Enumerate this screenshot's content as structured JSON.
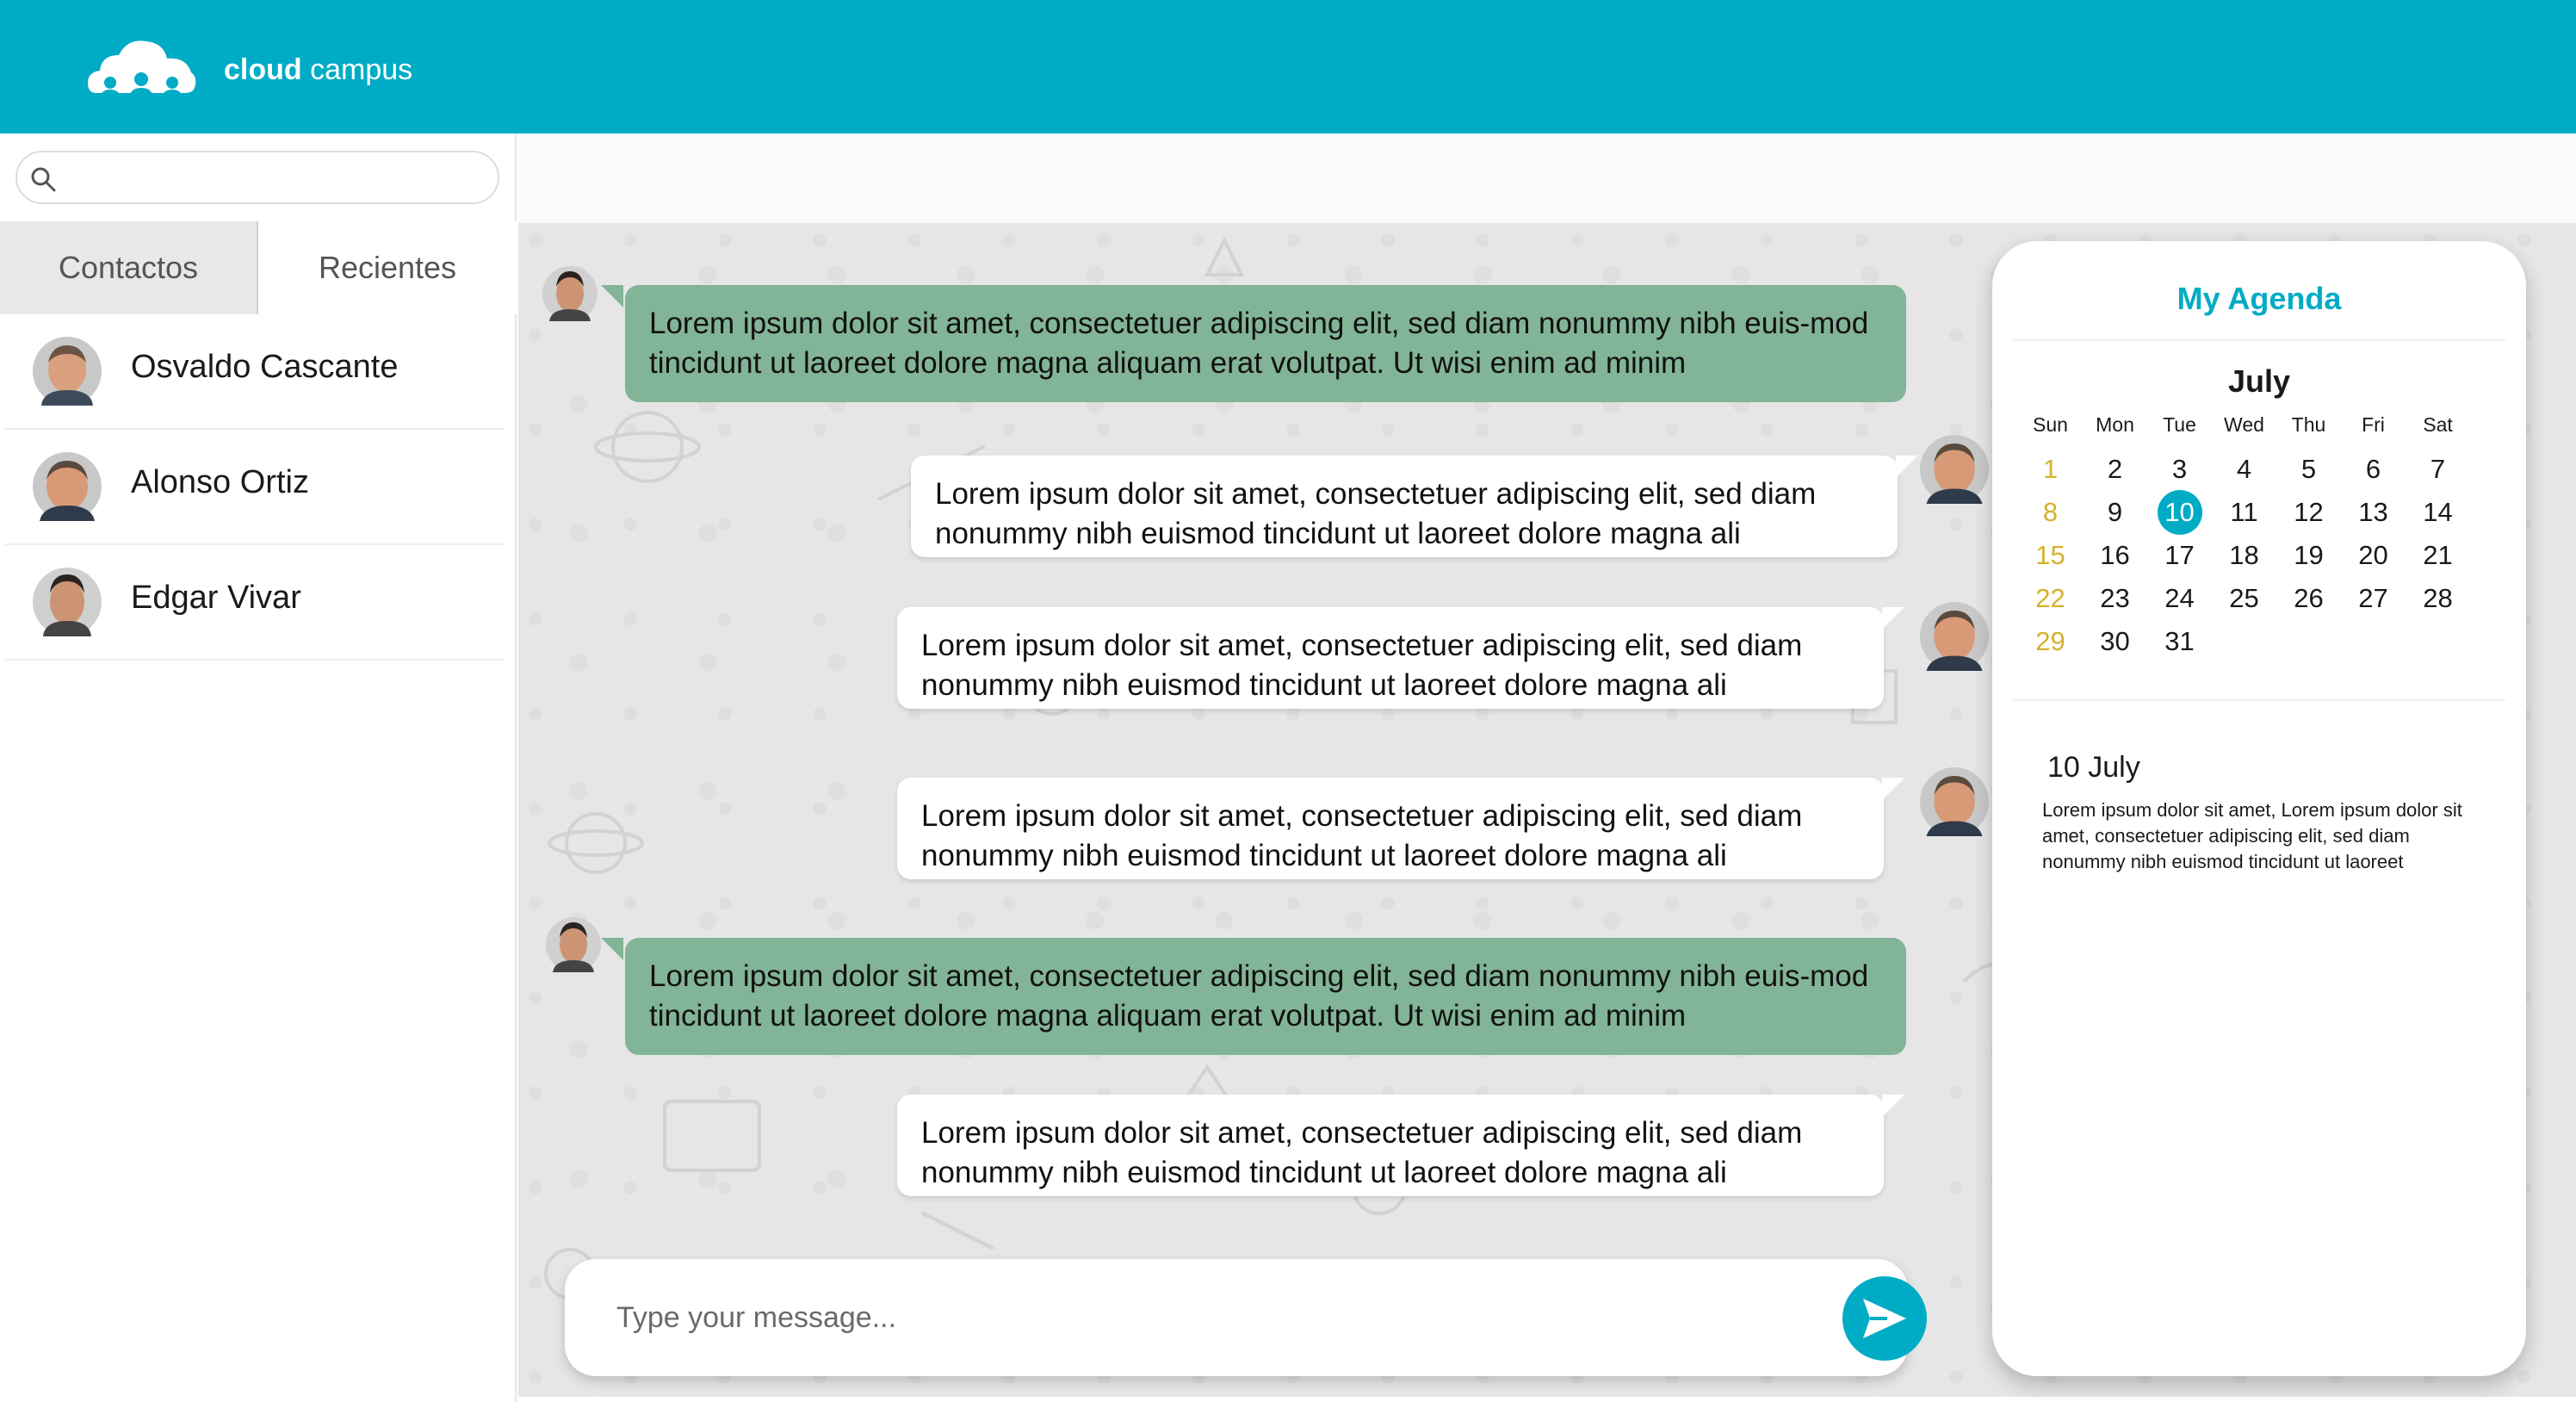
{
  "header": {
    "brand_bold": "cloud",
    "brand_light": "campus"
  },
  "sidebar": {
    "search_placeholder": "",
    "tabs": [
      "Contactos",
      "Recientes"
    ],
    "contacts": [
      {
        "name": "Osvaldo Cascante"
      },
      {
        "name": "Alonso Ortiz"
      },
      {
        "name": "Edgar Vivar"
      }
    ]
  },
  "chat": {
    "messages": [
      {
        "direction": "in",
        "text": "Lorem ipsum dolor sit amet, consectetuer adipiscing elit, sed diam nonummy nibh euis-mod tincidunt ut laoreet dolore magna aliquam erat volutpat. Ut wisi enim ad minim"
      },
      {
        "direction": "out",
        "text": "Lorem ipsum dolor sit amet, consectetuer adipiscing elit, sed diam nonummy nibh euismod tincidunt ut laoreet dolore magna ali"
      },
      {
        "direction": "out",
        "text": "Lorem ipsum dolor sit amet, consectetuer adipiscing elit, sed diam nonummy nibh euismod tincidunt ut laoreet dolore magna ali"
      },
      {
        "direction": "out",
        "text": "Lorem ipsum dolor sit amet, consectetuer adipiscing elit, sed diam nonummy nibh euismod tincidunt ut laoreet dolore magna ali"
      },
      {
        "direction": "in",
        "text": "Lorem ipsum dolor sit amet, consectetuer adipiscing elit, sed diam nonummy nibh euis-mod tincidunt ut laoreet dolore magna aliquam erat volutpat. Ut wisi enim ad minim"
      },
      {
        "direction": "out",
        "text": "Lorem ipsum dolor sit amet, consectetuer adipiscing elit, sed diam nonummy nibh euismod tincidunt ut laoreet dolore magna ali"
      }
    ],
    "composer_placeholder": "Type your message..."
  },
  "agenda": {
    "title": "My Agenda",
    "month": "July",
    "weekdays": [
      "Sun",
      "Mon",
      "Tue",
      "Wed",
      "Thu",
      "Fri",
      "Sat"
    ],
    "weeks": [
      [
        "1",
        "2",
        "3",
        "4",
        "5",
        "6",
        "7"
      ],
      [
        "8",
        "9",
        "10",
        "11",
        "12",
        "13",
        "14"
      ],
      [
        "15",
        "16",
        "17",
        "18",
        "19",
        "20",
        "21"
      ],
      [
        "22",
        "23",
        "24",
        "25",
        "26",
        "27",
        "28"
      ],
      [
        "29",
        "30",
        "31"
      ]
    ],
    "selected_day": "10",
    "event_date": "10 July",
    "event_text": "Lorem ipsum dolor sit amet, Lorem ipsum dolor sit amet, consectetuer adipiscing elit, sed diam nonummy nibh euismod tincidunt ut laoreet"
  },
  "colors": {
    "brand": "#00acc5",
    "incoming_bubble": "#82b497",
    "outgoing_bubble": "#ffffff",
    "sunday": "#d4b22a"
  },
  "icons": {
    "logo": "cloud-people-icon",
    "search": "search-icon",
    "send": "send-icon",
    "avatar": "user-avatar"
  }
}
